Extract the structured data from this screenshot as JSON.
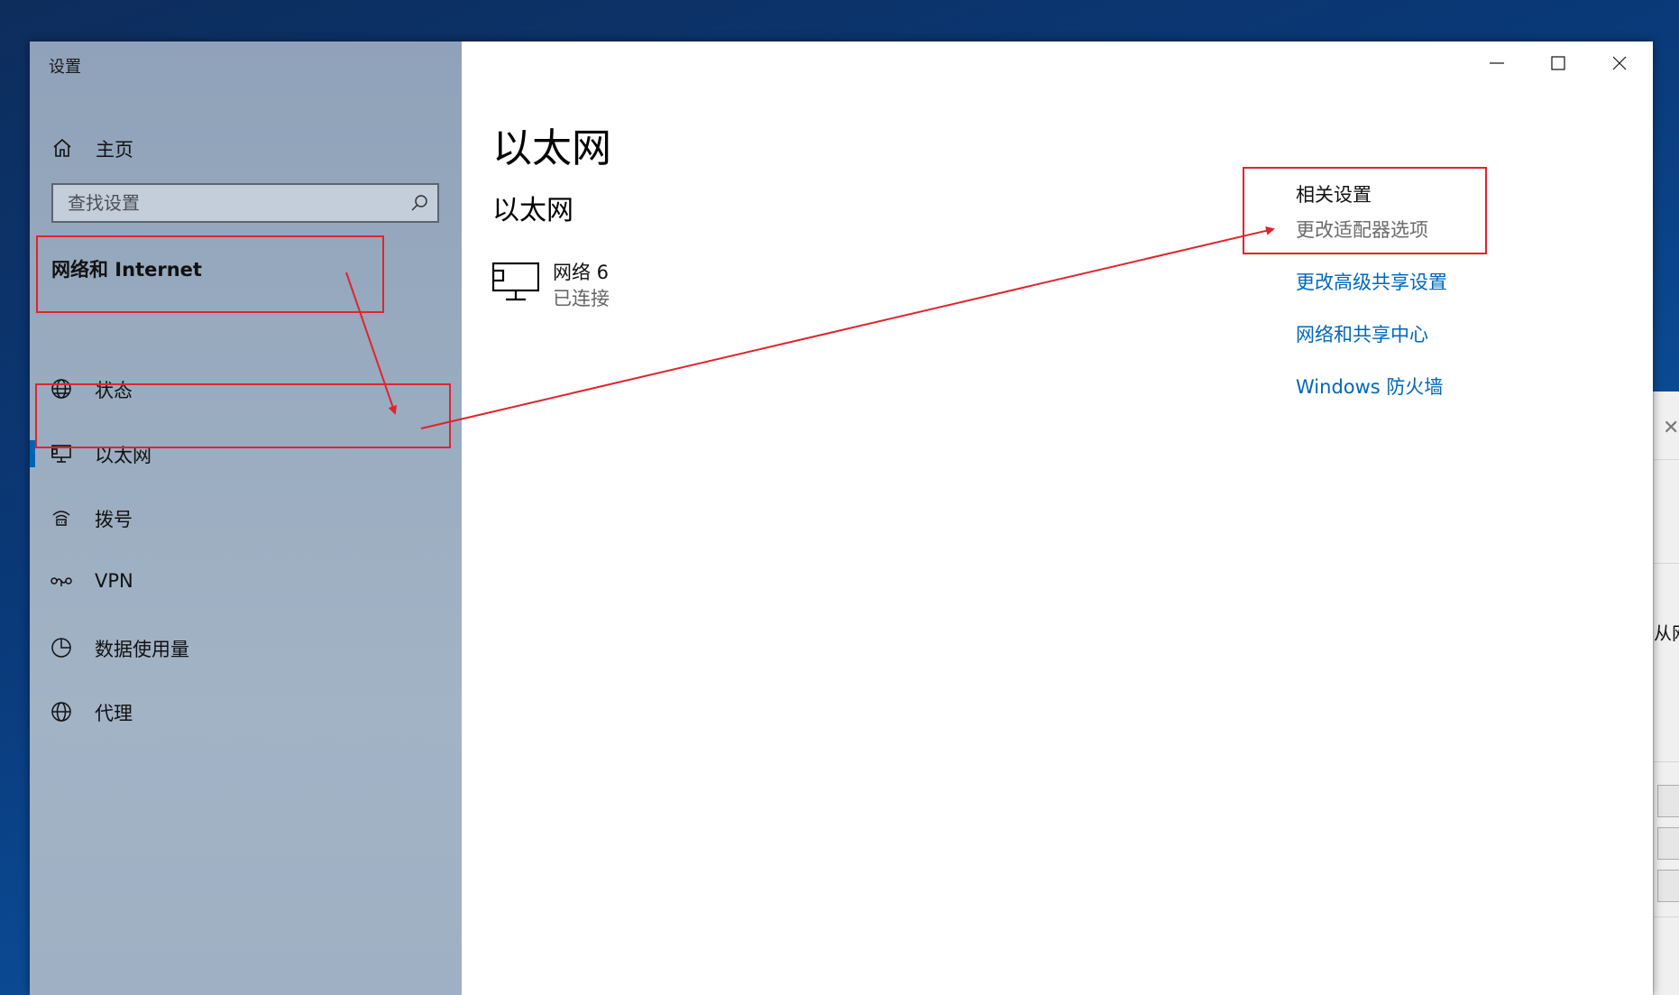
{
  "window": {
    "title": "设置"
  },
  "sidebar": {
    "home_label": "主页",
    "search_placeholder": "查找设置",
    "section_title": "网络和 Internet",
    "items": [
      {
        "label": "状态",
        "icon": "globe-status-icon"
      },
      {
        "label": "以太网",
        "icon": "ethernet-icon",
        "active": true
      },
      {
        "label": "拨号",
        "icon": "dialup-icon"
      },
      {
        "label": "VPN",
        "icon": "vpn-icon"
      },
      {
        "label": "数据使用量",
        "icon": "data-usage-icon"
      },
      {
        "label": "代理",
        "icon": "globe-proxy-icon"
      }
    ]
  },
  "main": {
    "heading": "以太网",
    "subheading": "以太网",
    "network": {
      "name": "网络 6",
      "status": "已连接"
    },
    "related": {
      "title": "相关设置",
      "links": [
        "更改适配器选项",
        "更改高级共享设置",
        "网络和共享中心",
        "Windows 防火墙"
      ]
    }
  },
  "background_window": {
    "partial_text": "从网"
  },
  "colors": {
    "accent": "#0067b8",
    "annotation": "#e0242d",
    "sidebar_bg": "#9aacc0"
  }
}
